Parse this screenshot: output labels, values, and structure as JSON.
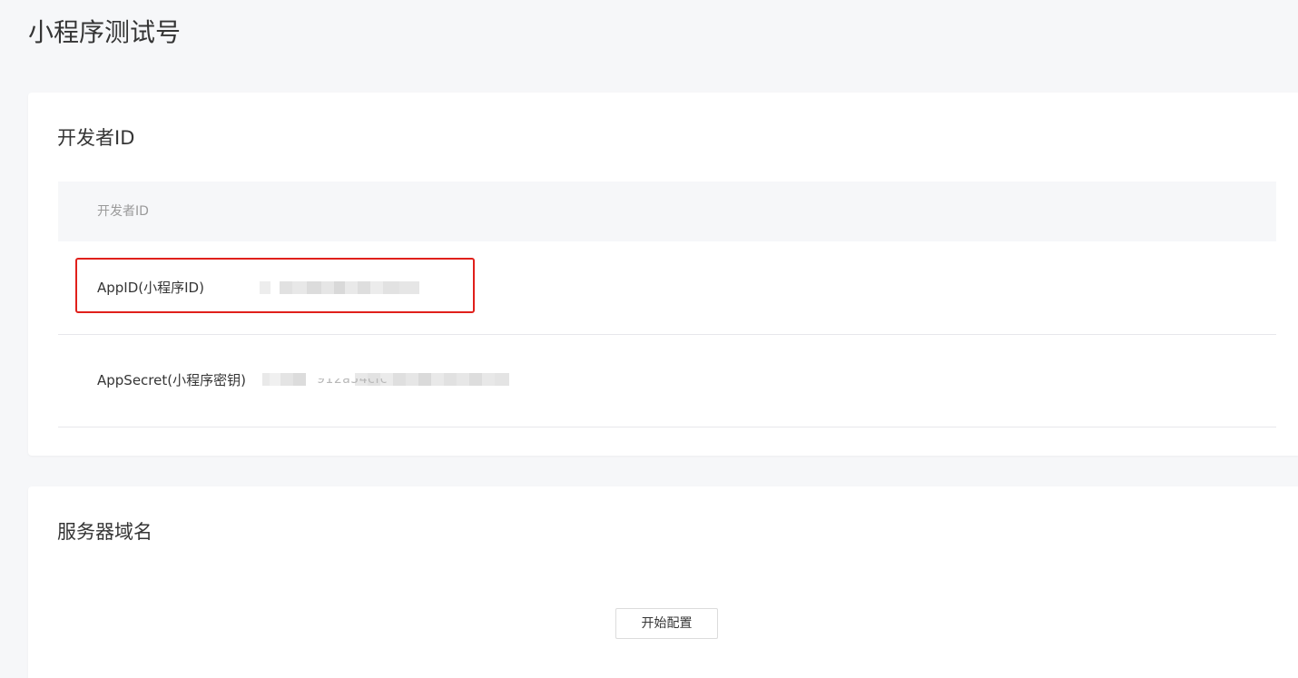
{
  "page": {
    "title": "小程序测试号"
  },
  "developer_section": {
    "title": "开发者ID",
    "table_header": "开发者ID",
    "rows": [
      {
        "label": "AppID(小程序ID)",
        "value_masked": ""
      },
      {
        "label": "AppSecret(小程序密钥)",
        "value_masked": "912a54cfc"
      }
    ],
    "highlight_color": "#e0201b"
  },
  "server_section": {
    "title": "服务器域名",
    "start_button_label": "开始配置"
  },
  "colors": {
    "background": "#f6f7f9",
    "card": "#ffffff",
    "text": "#353535",
    "muted": "#9a9a9a"
  }
}
